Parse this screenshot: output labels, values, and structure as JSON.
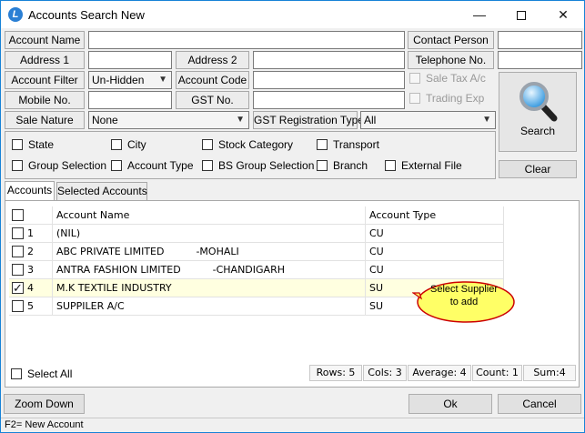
{
  "window": {
    "title": "Accounts Search New",
    "min_symbol": "—",
    "close_symbol": "✕"
  },
  "form": {
    "account_name_label": "Account Name",
    "account_name_value": "",
    "contact_person_label": "Contact Person",
    "contact_person_value": "",
    "address1_label": "Address 1",
    "address1_value": "",
    "address2_label": "Address 2",
    "address2_value": "",
    "telephone_label": "Telephone No.",
    "telephone_value": "",
    "account_filter_label": "Account Filter",
    "account_filter_value": "Un-Hidden",
    "account_code_label": "Account Code",
    "account_code_value": "",
    "sale_tax_label": "Sale Tax A/c",
    "mobile_label": "Mobile No.",
    "mobile_value": "",
    "gst_label": "GST No.",
    "gst_value": "",
    "trading_exp_label": "Trading Exp",
    "sale_nature_label": "Sale Nature",
    "sale_nature_value": "None",
    "gst_reg_type_label": "GST Registration Type",
    "gst_reg_type_value": "All"
  },
  "buttons": {
    "search": "Search",
    "clear": "Clear",
    "zoom_down": "Zoom Down",
    "ok": "Ok",
    "cancel": "Cancel"
  },
  "filters": {
    "state": "State",
    "city": "City",
    "stock_category": "Stock Category",
    "transport": "Transport",
    "group_selection": "Group Selection",
    "account_type": "Account Type",
    "bs_group_selection": "BS Group Selection",
    "branch": "Branch",
    "external_file": "External File"
  },
  "tabs": {
    "accounts": "Accounts",
    "selected_accounts": "Selected Accounts"
  },
  "grid": {
    "columns": {
      "name": "Account Name",
      "type": "Account Type"
    },
    "rows": [
      {
        "no": "1",
        "name": "(NIL)",
        "type": "CU",
        "checked": false
      },
      {
        "no": "2",
        "name": "ABC PRIVATE LIMITED          -MOHALI",
        "type": "CU",
        "checked": false
      },
      {
        "no": "3",
        "name": "ANTRA FASHION LIMITED          -CHANDIGARH",
        "type": "CU",
        "checked": false
      },
      {
        "no": "4",
        "name": "M.K TEXTILE INDUSTRY",
        "type": "SU",
        "checked": true
      },
      {
        "no": "5",
        "name": "SUPPILER A/C",
        "type": "SU",
        "checked": false
      }
    ],
    "select_all": "Select All"
  },
  "stats": {
    "rows": "Rows: 5",
    "cols": "Cols: 3",
    "average": "Average: 4",
    "count": "Count: 1",
    "sum": "Sum:4"
  },
  "callout": {
    "line1": "Select  Supplier",
    "line2": "to  add"
  },
  "status_bar": "F2= New Account",
  "colors": {
    "accent": "#1883d7",
    "callout_fill": "#ffff66",
    "callout_border": "#cc0000",
    "selected_row": "#ffffe0"
  }
}
